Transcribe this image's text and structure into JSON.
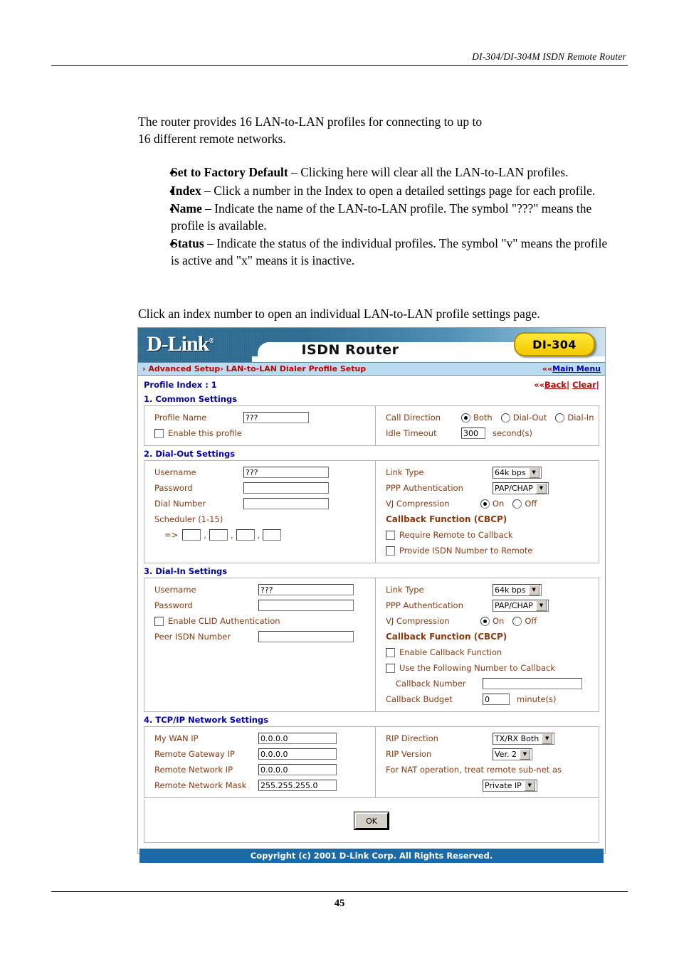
{
  "document": {
    "header": "DI-304/DI-304M ISDN Remote Router",
    "page_number": "45",
    "intro": "The router provides 16 LAN-to-LAN profiles for connecting to up to 16 different remote networks.",
    "bullet_marker": "♦",
    "bullets": [
      {
        "term": "Set to Factory Default",
        "dash": " – ",
        "text": "Clicking here will clear all the LAN-to-LAN profiles."
      },
      {
        "term": "Index",
        "dash": " – ",
        "text": "Click a number in the Index to open a detailed settings page for each profile."
      },
      {
        "term": "Name",
        "dash": " – ",
        "text": "Indicate the name of the LAN-to-LAN profile. The symbol \"???\" means the profile is available."
      },
      {
        "term": "Status",
        "dash": " – ",
        "text": "Indicate the status of the individual profiles. The symbol \"v\" means the profile is active and \"x\" means it is inactive."
      }
    ],
    "closing": "Click an index number to open an individual LAN-to-LAN profile settings page."
  },
  "router_ui": {
    "brand": "D-Link",
    "brand_reg": "®",
    "product_title": "ISDN Router",
    "model_badge": "DI-304",
    "breadcrumb": "› Advanced Setup› LAN-to-LAN Dialer Profile Setup",
    "main_menu_prefix": "«",
    "main_menu": "Main Menu",
    "profile_index": "Profile Index : 1",
    "back_prefix": "«",
    "back_link": "Back",
    "pipe": "| ",
    "clear_link": "Clear",
    "pipe_end": "|",
    "copyright": "Copyright (c) 2001 D-Link Corp. All Rights Reserved.",
    "ok_button": "OK",
    "sections": {
      "common": {
        "title": "1. Common Settings",
        "profile_name_label": "Profile Name",
        "profile_name_value": "???",
        "enable_profile_label": "Enable this profile",
        "enable_profile_checked": false,
        "call_direction_label": "Call Direction",
        "call_direction_options": [
          "Both",
          "Dial-Out",
          "Dial-In"
        ],
        "call_direction_selected": "Both",
        "idle_timeout_label": "Idle Timeout",
        "idle_timeout_value": "300",
        "idle_timeout_unit": "second(s)"
      },
      "dial_out": {
        "title": "2. Dial-Out Settings",
        "username_label": "Username",
        "username_value": "???",
        "password_label": "Password",
        "password_value": "",
        "dial_number_label": "Dial Number",
        "dial_number_value": "",
        "scheduler_label": "Scheduler (1-15)",
        "scheduler_arrow": "=>",
        "scheduler_values": [
          "",
          "",
          "",
          ""
        ],
        "scheduler_sep": ",",
        "link_type_label": "Link Type",
        "link_type_value": "64k bps",
        "ppp_auth_label": "PPP Authentication",
        "ppp_auth_value": "PAP/CHAP",
        "vj_label": "VJ Compression",
        "vj_options": [
          "On",
          "Off"
        ],
        "vj_selected": "On",
        "callback_title": "Callback Function (CBCP)",
        "require_remote_label": "Require Remote to Callback",
        "require_remote_checked": false,
        "provide_isdn_label": "Provide ISDN Number to Remote",
        "provide_isdn_checked": false
      },
      "dial_in": {
        "title": "3. Dial-In Settings",
        "username_label": "Username",
        "username_value": "???",
        "password_label": "Password",
        "password_value": "",
        "clid_label": "Enable CLID Authentication",
        "clid_checked": false,
        "peer_isdn_label": "Peer ISDN Number",
        "peer_isdn_value": "",
        "link_type_label": "Link Type",
        "link_type_value": "64k bps",
        "ppp_auth_label": "PPP Authentication",
        "ppp_auth_value": "PAP/CHAP",
        "vj_label": "VJ Compression",
        "vj_options": [
          "On",
          "Off"
        ],
        "vj_selected": "On",
        "callback_title": "Callback Function (CBCP)",
        "enable_callback_label": "Enable Callback Function",
        "enable_callback_checked": false,
        "use_following_label": "Use the Following Number to Callback",
        "use_following_checked": false,
        "callback_number_label": "Callback Number",
        "callback_number_value": "",
        "callback_budget_label": "Callback Budget",
        "callback_budget_value": "0",
        "callback_budget_unit": "minute(s)"
      },
      "tcpip": {
        "title": "4. TCP/IP Network Settings",
        "my_wan_ip_label": "My WAN IP",
        "my_wan_ip_value": "0.0.0.0",
        "remote_gateway_label": "Remote Gateway IP",
        "remote_gateway_value": "0.0.0.0",
        "remote_network_ip_label": "Remote Network IP",
        "remote_network_ip_value": "0.0.0.0",
        "remote_network_mask_label": "Remote Network Mask",
        "remote_network_mask_value": "255.255.255.0",
        "rip_direction_label": "RIP Direction",
        "rip_direction_value": "TX/RX Both",
        "rip_version_label": "RIP Version",
        "rip_version_value": "Ver. 2",
        "nat_note": "For NAT operation, treat remote sub-net as",
        "nat_value": "Private IP"
      }
    }
  },
  "colors": {
    "banner_blue": "#2d6a91",
    "nav_strip": "#b9dcf0",
    "label_brown": "#8b3a10",
    "section_blue": "#0000b0",
    "crumb_red": "#c00000",
    "badge_yellow": "#ffe93a",
    "copyright_bar": "#1b6aa5"
  }
}
